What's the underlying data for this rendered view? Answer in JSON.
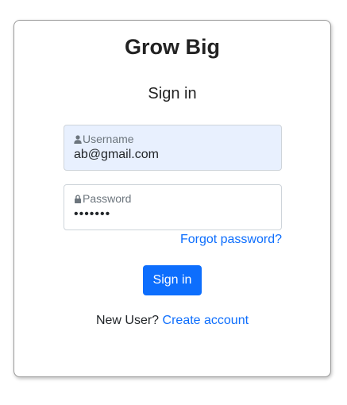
{
  "header": {
    "brand": "Grow Big",
    "subtitle": "Sign in"
  },
  "form": {
    "username": {
      "label": "Username",
      "value": "ab@gmail.com",
      "icon": "user-icon"
    },
    "password": {
      "label": "Password",
      "value": "•••••••",
      "icon": "lock-icon"
    },
    "forgot_label": "Forgot password?",
    "submit_label": "Sign in"
  },
  "footer": {
    "prompt": "New User?",
    "create_label": "Create account"
  },
  "colors": {
    "accent": "#0d6efd",
    "autofill_bg": "#e8f0fe"
  }
}
